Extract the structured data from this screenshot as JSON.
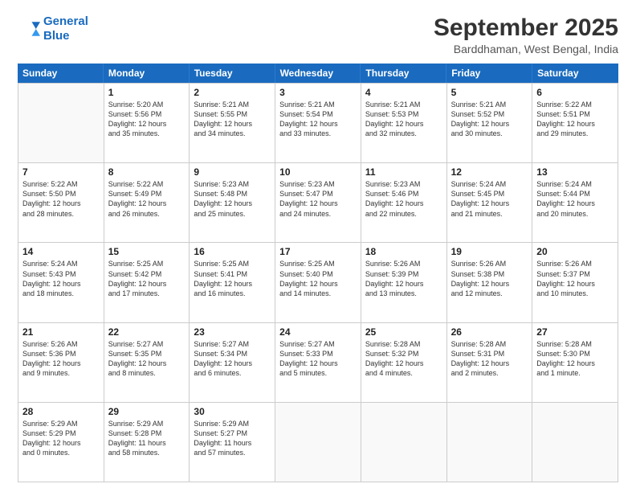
{
  "header": {
    "logo_line1": "General",
    "logo_line2": "Blue",
    "month": "September 2025",
    "location": "Barddhaman, West Bengal, India"
  },
  "weekdays": [
    "Sunday",
    "Monday",
    "Tuesday",
    "Wednesday",
    "Thursday",
    "Friday",
    "Saturday"
  ],
  "weeks": [
    [
      {
        "day": "",
        "lines": []
      },
      {
        "day": "1",
        "lines": [
          "Sunrise: 5:20 AM",
          "Sunset: 5:56 PM",
          "Daylight: 12 hours",
          "and 35 minutes."
        ]
      },
      {
        "day": "2",
        "lines": [
          "Sunrise: 5:21 AM",
          "Sunset: 5:55 PM",
          "Daylight: 12 hours",
          "and 34 minutes."
        ]
      },
      {
        "day": "3",
        "lines": [
          "Sunrise: 5:21 AM",
          "Sunset: 5:54 PM",
          "Daylight: 12 hours",
          "and 33 minutes."
        ]
      },
      {
        "day": "4",
        "lines": [
          "Sunrise: 5:21 AM",
          "Sunset: 5:53 PM",
          "Daylight: 12 hours",
          "and 32 minutes."
        ]
      },
      {
        "day": "5",
        "lines": [
          "Sunrise: 5:21 AM",
          "Sunset: 5:52 PM",
          "Daylight: 12 hours",
          "and 30 minutes."
        ]
      },
      {
        "day": "6",
        "lines": [
          "Sunrise: 5:22 AM",
          "Sunset: 5:51 PM",
          "Daylight: 12 hours",
          "and 29 minutes."
        ]
      }
    ],
    [
      {
        "day": "7",
        "lines": [
          "Sunrise: 5:22 AM",
          "Sunset: 5:50 PM",
          "Daylight: 12 hours",
          "and 28 minutes."
        ]
      },
      {
        "day": "8",
        "lines": [
          "Sunrise: 5:22 AM",
          "Sunset: 5:49 PM",
          "Daylight: 12 hours",
          "and 26 minutes."
        ]
      },
      {
        "day": "9",
        "lines": [
          "Sunrise: 5:23 AM",
          "Sunset: 5:48 PM",
          "Daylight: 12 hours",
          "and 25 minutes."
        ]
      },
      {
        "day": "10",
        "lines": [
          "Sunrise: 5:23 AM",
          "Sunset: 5:47 PM",
          "Daylight: 12 hours",
          "and 24 minutes."
        ]
      },
      {
        "day": "11",
        "lines": [
          "Sunrise: 5:23 AM",
          "Sunset: 5:46 PM",
          "Daylight: 12 hours",
          "and 22 minutes."
        ]
      },
      {
        "day": "12",
        "lines": [
          "Sunrise: 5:24 AM",
          "Sunset: 5:45 PM",
          "Daylight: 12 hours",
          "and 21 minutes."
        ]
      },
      {
        "day": "13",
        "lines": [
          "Sunrise: 5:24 AM",
          "Sunset: 5:44 PM",
          "Daylight: 12 hours",
          "and 20 minutes."
        ]
      }
    ],
    [
      {
        "day": "14",
        "lines": [
          "Sunrise: 5:24 AM",
          "Sunset: 5:43 PM",
          "Daylight: 12 hours",
          "and 18 minutes."
        ]
      },
      {
        "day": "15",
        "lines": [
          "Sunrise: 5:25 AM",
          "Sunset: 5:42 PM",
          "Daylight: 12 hours",
          "and 17 minutes."
        ]
      },
      {
        "day": "16",
        "lines": [
          "Sunrise: 5:25 AM",
          "Sunset: 5:41 PM",
          "Daylight: 12 hours",
          "and 16 minutes."
        ]
      },
      {
        "day": "17",
        "lines": [
          "Sunrise: 5:25 AM",
          "Sunset: 5:40 PM",
          "Daylight: 12 hours",
          "and 14 minutes."
        ]
      },
      {
        "day": "18",
        "lines": [
          "Sunrise: 5:26 AM",
          "Sunset: 5:39 PM",
          "Daylight: 12 hours",
          "and 13 minutes."
        ]
      },
      {
        "day": "19",
        "lines": [
          "Sunrise: 5:26 AM",
          "Sunset: 5:38 PM",
          "Daylight: 12 hours",
          "and 12 minutes."
        ]
      },
      {
        "day": "20",
        "lines": [
          "Sunrise: 5:26 AM",
          "Sunset: 5:37 PM",
          "Daylight: 12 hours",
          "and 10 minutes."
        ]
      }
    ],
    [
      {
        "day": "21",
        "lines": [
          "Sunrise: 5:26 AM",
          "Sunset: 5:36 PM",
          "Daylight: 12 hours",
          "and 9 minutes."
        ]
      },
      {
        "day": "22",
        "lines": [
          "Sunrise: 5:27 AM",
          "Sunset: 5:35 PM",
          "Daylight: 12 hours",
          "and 8 minutes."
        ]
      },
      {
        "day": "23",
        "lines": [
          "Sunrise: 5:27 AM",
          "Sunset: 5:34 PM",
          "Daylight: 12 hours",
          "and 6 minutes."
        ]
      },
      {
        "day": "24",
        "lines": [
          "Sunrise: 5:27 AM",
          "Sunset: 5:33 PM",
          "Daylight: 12 hours",
          "and 5 minutes."
        ]
      },
      {
        "day": "25",
        "lines": [
          "Sunrise: 5:28 AM",
          "Sunset: 5:32 PM",
          "Daylight: 12 hours",
          "and 4 minutes."
        ]
      },
      {
        "day": "26",
        "lines": [
          "Sunrise: 5:28 AM",
          "Sunset: 5:31 PM",
          "Daylight: 12 hours",
          "and 2 minutes."
        ]
      },
      {
        "day": "27",
        "lines": [
          "Sunrise: 5:28 AM",
          "Sunset: 5:30 PM",
          "Daylight: 12 hours",
          "and 1 minute."
        ]
      }
    ],
    [
      {
        "day": "28",
        "lines": [
          "Sunrise: 5:29 AM",
          "Sunset: 5:29 PM",
          "Daylight: 12 hours",
          "and 0 minutes."
        ]
      },
      {
        "day": "29",
        "lines": [
          "Sunrise: 5:29 AM",
          "Sunset: 5:28 PM",
          "Daylight: 11 hours",
          "and 58 minutes."
        ]
      },
      {
        "day": "30",
        "lines": [
          "Sunrise: 5:29 AM",
          "Sunset: 5:27 PM",
          "Daylight: 11 hours",
          "and 57 minutes."
        ]
      },
      {
        "day": "",
        "lines": []
      },
      {
        "day": "",
        "lines": []
      },
      {
        "day": "",
        "lines": []
      },
      {
        "day": "",
        "lines": []
      }
    ]
  ]
}
